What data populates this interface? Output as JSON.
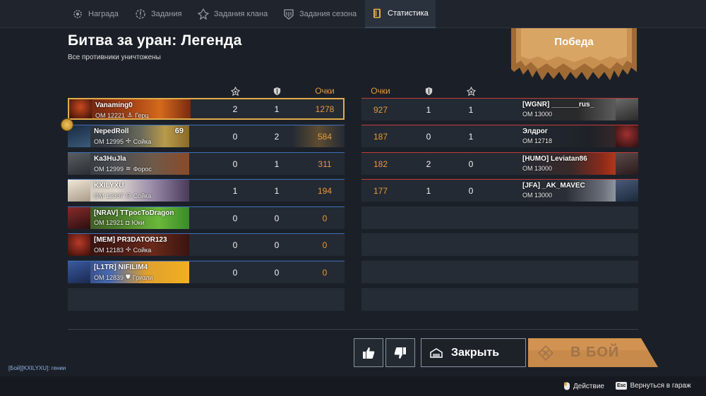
{
  "tabs": [
    {
      "label": "Награда",
      "icon": "gear-icon",
      "active": false
    },
    {
      "label": "Задания",
      "icon": "alert-icon",
      "active": false
    },
    {
      "label": "Задания клана",
      "icon": "clan-icon",
      "active": false
    },
    {
      "label": "Задания сезона",
      "icon": "season-icon",
      "active": false
    },
    {
      "label": "Статистика",
      "icon": "book-icon",
      "active": true
    }
  ],
  "header": {
    "title": "Битва за уран: Легенда",
    "subtitle": "Все противники уничтожены",
    "result": "Победа"
  },
  "columns": {
    "left_score": "Очки",
    "right_score": "Очки"
  },
  "team_left": [
    {
      "name": "Vanaming0",
      "om": "ОМ 12221",
      "vehicle": "Герц",
      "kills": "2",
      "assists": "1",
      "score": "1278",
      "me": true,
      "level": ""
    },
    {
      "name": "NepedRoll",
      "om": "ОМ 12995",
      "vehicle": "Сойка",
      "kills": "0",
      "assists": "2",
      "score": "584",
      "me": false,
      "level": "69"
    },
    {
      "name": "Ka3HuJla",
      "om": "ОМ 12999",
      "vehicle": "Форос",
      "kills": "0",
      "assists": "1",
      "score": "311",
      "me": false,
      "level": ""
    },
    {
      "name": "KXILYXU",
      "om": "ОМ 12307",
      "vehicle": "Сойка",
      "kills": "1",
      "assists": "1",
      "score": "194",
      "me": false,
      "level": ""
    },
    {
      "name": "[NRAV] TTpocToDragon",
      "om": "ОМ 12921",
      "vehicle": "Юки",
      "kills": "0",
      "assists": "0",
      "score": "0",
      "me": false,
      "level": ""
    },
    {
      "name": "[MEM] PR3DATOR123",
      "om": "ОМ 12183",
      "vehicle": "Сойка",
      "kills": "0",
      "assists": "0",
      "score": "0",
      "me": false,
      "level": ""
    },
    {
      "name": "[L1TR] NIFILIM4",
      "om": "ОМ 12839",
      "vehicle": "Гризли",
      "kills": "0",
      "assists": "0",
      "score": "0",
      "me": false,
      "level": ""
    }
  ],
  "team_right": [
    {
      "name": "[WGNR] _______rus_",
      "om": "ОМ 13000",
      "score": "927",
      "assists": "1",
      "kills": "1"
    },
    {
      "name": "Элдрог",
      "om": "ОМ 12718",
      "score": "187",
      "assists": "0",
      "kills": "1"
    },
    {
      "name": "[HUMO] Leviatan86",
      "om": "ОМ 13000",
      "score": "182",
      "assists": "2",
      "kills": "0"
    },
    {
      "name": "[JFA] _AK_MAVEC",
      "om": "ОМ 13000",
      "score": "177",
      "assists": "1",
      "kills": "0"
    }
  ],
  "actions": {
    "close": "Закрыть",
    "fight": "В БОЙ"
  },
  "chat": "[Бой][KXILYXU]: гении",
  "hints": {
    "action": "Действие",
    "garage": "Вернуться в гараж",
    "esc_key": "Esc"
  },
  "colors": {
    "ally_line": "#3e6fb8",
    "enemy_line": "#c23b3b",
    "score": "#e69a3a",
    "highlight": "#e2ac4b"
  }
}
